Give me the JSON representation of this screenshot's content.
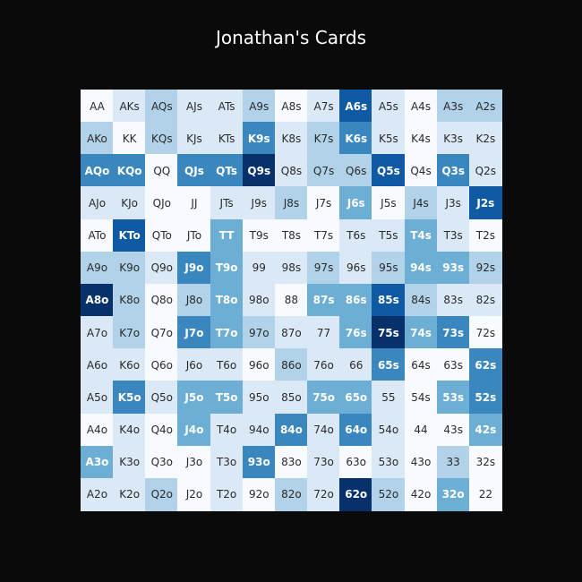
{
  "chart_data": {
    "type": "heatmap",
    "title": "Jonathan's Cards",
    "rows": [
      [
        "AA",
        "AKs",
        "AQs",
        "AJs",
        "ATs",
        "A9s",
        "A8s",
        "A7s",
        "A6s",
        "A5s",
        "A4s",
        "A3s",
        "A2s"
      ],
      [
        "AKo",
        "KK",
        "KQs",
        "KJs",
        "KTs",
        "K9s",
        "K8s",
        "K7s",
        "K6s",
        "K5s",
        "K4s",
        "K3s",
        "K2s"
      ],
      [
        "AQo",
        "KQo",
        "QQ",
        "QJs",
        "QTs",
        "Q9s",
        "Q8s",
        "Q7s",
        "Q6s",
        "Q5s",
        "Q4s",
        "Q3s",
        "Q2s"
      ],
      [
        "AJo",
        "KJo",
        "QJo",
        "JJ",
        "JTs",
        "J9s",
        "J8s",
        "J7s",
        "J6s",
        "J5s",
        "J4s",
        "J3s",
        "J2s"
      ],
      [
        "ATo",
        "KTo",
        "QTo",
        "JTo",
        "TT",
        "T9s",
        "T8s",
        "T7s",
        "T6s",
        "T5s",
        "T4s",
        "T3s",
        "T2s"
      ],
      [
        "A9o",
        "K9o",
        "Q9o",
        "J9o",
        "T9o",
        "99",
        "98s",
        "97s",
        "96s",
        "95s",
        "94s",
        "93s",
        "92s"
      ],
      [
        "A8o",
        "K8o",
        "Q8o",
        "J8o",
        "T8o",
        "98o",
        "88",
        "87s",
        "86s",
        "85s",
        "84s",
        "83s",
        "82s"
      ],
      [
        "A7o",
        "K7o",
        "Q7o",
        "J7o",
        "T7o",
        "97o",
        "87o",
        "77",
        "76s",
        "75s",
        "74s",
        "73s",
        "72s"
      ],
      [
        "A6o",
        "K6o",
        "Q6o",
        "J6o",
        "T6o",
        "96o",
        "86o",
        "76o",
        "66",
        "65s",
        "64s",
        "63s",
        "62s"
      ],
      [
        "A5o",
        "K5o",
        "Q5o",
        "J5o",
        "T5o",
        "95o",
        "85o",
        "75o",
        "65o",
        "55",
        "54s",
        "53s",
        "52s"
      ],
      [
        "A4o",
        "K4o",
        "Q4o",
        "J4o",
        "T4o",
        "94o",
        "84o",
        "74o",
        "64o",
        "54o",
        "44",
        "43s",
        "42s"
      ],
      [
        "A3o",
        "K3o",
        "Q3o",
        "J3o",
        "T3o",
        "93o",
        "83o",
        "73o",
        "63o",
        "53o",
        "43o",
        "33",
        "32s"
      ],
      [
        "A2o",
        "K2o",
        "Q2o",
        "J2o",
        "T2o",
        "92o",
        "82o",
        "72o",
        "62o",
        "52o",
        "42o",
        "32o",
        "22"
      ]
    ],
    "values": [
      [
        0,
        1,
        2,
        1,
        1,
        2,
        0,
        1,
        5,
        1,
        0,
        2,
        2
      ],
      [
        2,
        0,
        2,
        1,
        1,
        4,
        1,
        2,
        4,
        1,
        0,
        1,
        1
      ],
      [
        4,
        4,
        0,
        4,
        4,
        6,
        1,
        2,
        2,
        5,
        0,
        4,
        1
      ],
      [
        1,
        1,
        0,
        0,
        1,
        1,
        2,
        0,
        3,
        0,
        2,
        1,
        5
      ],
      [
        0,
        5,
        0,
        0,
        3,
        0,
        0,
        0,
        1,
        1,
        3,
        1,
        0
      ],
      [
        2,
        2,
        1,
        4,
        3,
        1,
        1,
        2,
        1,
        2,
        3,
        3,
        2
      ],
      [
        6,
        2,
        0,
        2,
        3,
        1,
        0,
        3,
        3,
        5,
        2,
        1,
        1
      ],
      [
        1,
        2,
        0,
        4,
        3,
        2,
        1,
        1,
        3,
        6,
        3,
        4,
        0
      ],
      [
        1,
        1,
        0,
        1,
        1,
        0,
        2,
        1,
        1,
        4,
        0,
        0,
        4
      ],
      [
        1,
        4,
        1,
        3,
        3,
        1,
        1,
        3,
        3,
        1,
        0,
        3,
        4
      ],
      [
        0,
        1,
        0,
        3,
        1,
        1,
        4,
        1,
        4,
        1,
        0,
        0,
        3
      ],
      [
        3,
        1,
        0,
        0,
        1,
        4,
        0,
        1,
        0,
        1,
        0,
        2,
        0
      ],
      [
        1,
        1,
        2,
        0,
        1,
        0,
        2,
        1,
        6,
        2,
        0,
        3,
        0
      ]
    ],
    "colorscale": [
      "#f7fbff",
      "#dbe9f6",
      "#b1d2e8",
      "#6daed5",
      "#3a87c0",
      "#0f5aa3",
      "#08306b"
    ]
  }
}
